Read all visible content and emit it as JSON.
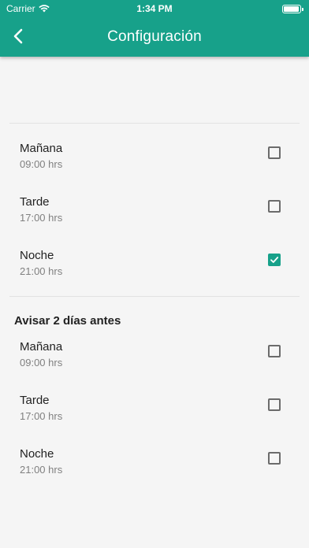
{
  "status_bar": {
    "carrier": "Carrier",
    "time": "1:34 PM"
  },
  "header": {
    "title": "Configuración",
    "back_icon": "chevron-left-icon",
    "color": "#17a18a"
  },
  "group1": {
    "items": [
      {
        "label": "Mañana",
        "time": "09:00 hrs",
        "checked": false
      },
      {
        "label": "Tarde",
        "time": "17:00 hrs",
        "checked": false
      },
      {
        "label": "Noche",
        "time": "21:00 hrs",
        "checked": true
      }
    ]
  },
  "group2": {
    "title": "Avisar 2 días antes",
    "items": [
      {
        "label": "Mañana",
        "time": "09:00 hrs",
        "checked": false
      },
      {
        "label": "Tarde",
        "time": "17:00 hrs",
        "checked": false
      },
      {
        "label": "Noche",
        "time": "21:00 hrs",
        "checked": false
      }
    ]
  }
}
